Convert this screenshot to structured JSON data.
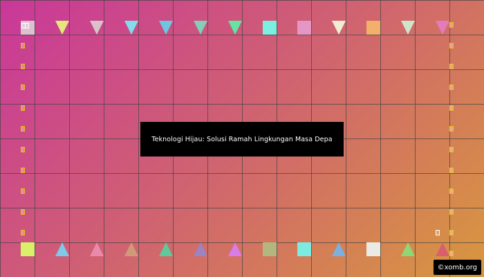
{
  "title": "Teknologi Hijau: Solusi Ramah Lingkungan Masa Depa",
  "watermark": "©xomb.org",
  "top_row": [
    {
      "shape": "square",
      "color": "#dcc1d0"
    },
    {
      "shape": "triangle-down",
      "color": "#e3e77c"
    },
    {
      "shape": "triangle-down",
      "color": "#d8c3c8"
    },
    {
      "shape": "triangle-down",
      "color": "#83dcec"
    },
    {
      "shape": "triangle-down",
      "color": "#6fc6e0"
    },
    {
      "shape": "triangle-down",
      "color": "#84ceb7"
    },
    {
      "shape": "triangle-down",
      "color": "#64e4a0"
    },
    {
      "shape": "square",
      "color": "#7bf0e0"
    },
    {
      "shape": "square",
      "color": "#e497c4"
    },
    {
      "shape": "triangle-down",
      "color": "#f2ecd2"
    },
    {
      "shape": "square",
      "color": "#f2b06a"
    },
    {
      "shape": "triangle-down",
      "color": "#cfe4c8"
    },
    {
      "shape": "triangle-down",
      "color": "#e37bbd"
    }
  ],
  "bottom_row": [
    {
      "shape": "square",
      "color": "#d8f06a"
    },
    {
      "shape": "triangle-up",
      "color": "#7fc8e8"
    },
    {
      "shape": "triangle-up",
      "color": "#e98aab"
    },
    {
      "shape": "triangle-up",
      "color": "#d09a78"
    },
    {
      "shape": "triangle-up",
      "color": "#5fc99b"
    },
    {
      "shape": "triangle-up",
      "color": "#9b83c4"
    },
    {
      "shape": "triangle-up",
      "color": "#d77ce8"
    },
    {
      "shape": "square",
      "color": "#b4b680"
    },
    {
      "shape": "square",
      "color": "#7debe2"
    },
    {
      "shape": "triangle-up",
      "color": "#7bb0df"
    },
    {
      "shape": "square",
      "color": "#e9ebe4"
    },
    {
      "shape": "triangle-up",
      "color": "#8ed774"
    },
    {
      "shape": "triangle-up",
      "color": "#d8606e"
    }
  ]
}
